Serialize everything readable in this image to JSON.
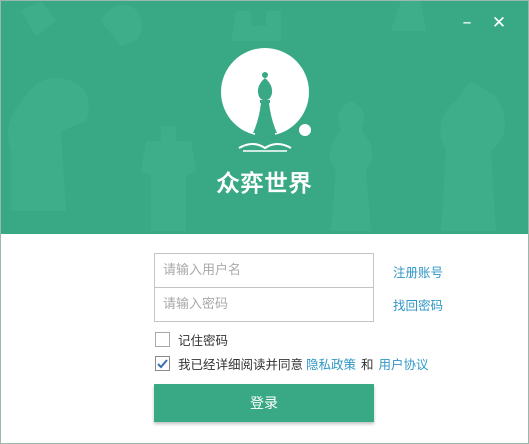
{
  "window": {
    "minimize_symbol": "–",
    "close_symbol": "✕"
  },
  "brand": {
    "title": "众弈世界",
    "primary_color": "#38a984",
    "link_color": "#2f97c5"
  },
  "form": {
    "username_placeholder": "请输入用户名",
    "password_placeholder": "请输入密码",
    "register_link": "注册账号",
    "forgot_link": "找回密码",
    "remember_label": "记住密码",
    "remember_checked": false,
    "agree_prefix": "我已经详细阅读并同意",
    "privacy_link": "隐私政策",
    "agree_and": "和",
    "terms_link": "用户协议",
    "agree_checked": true,
    "login_button": "登录"
  }
}
